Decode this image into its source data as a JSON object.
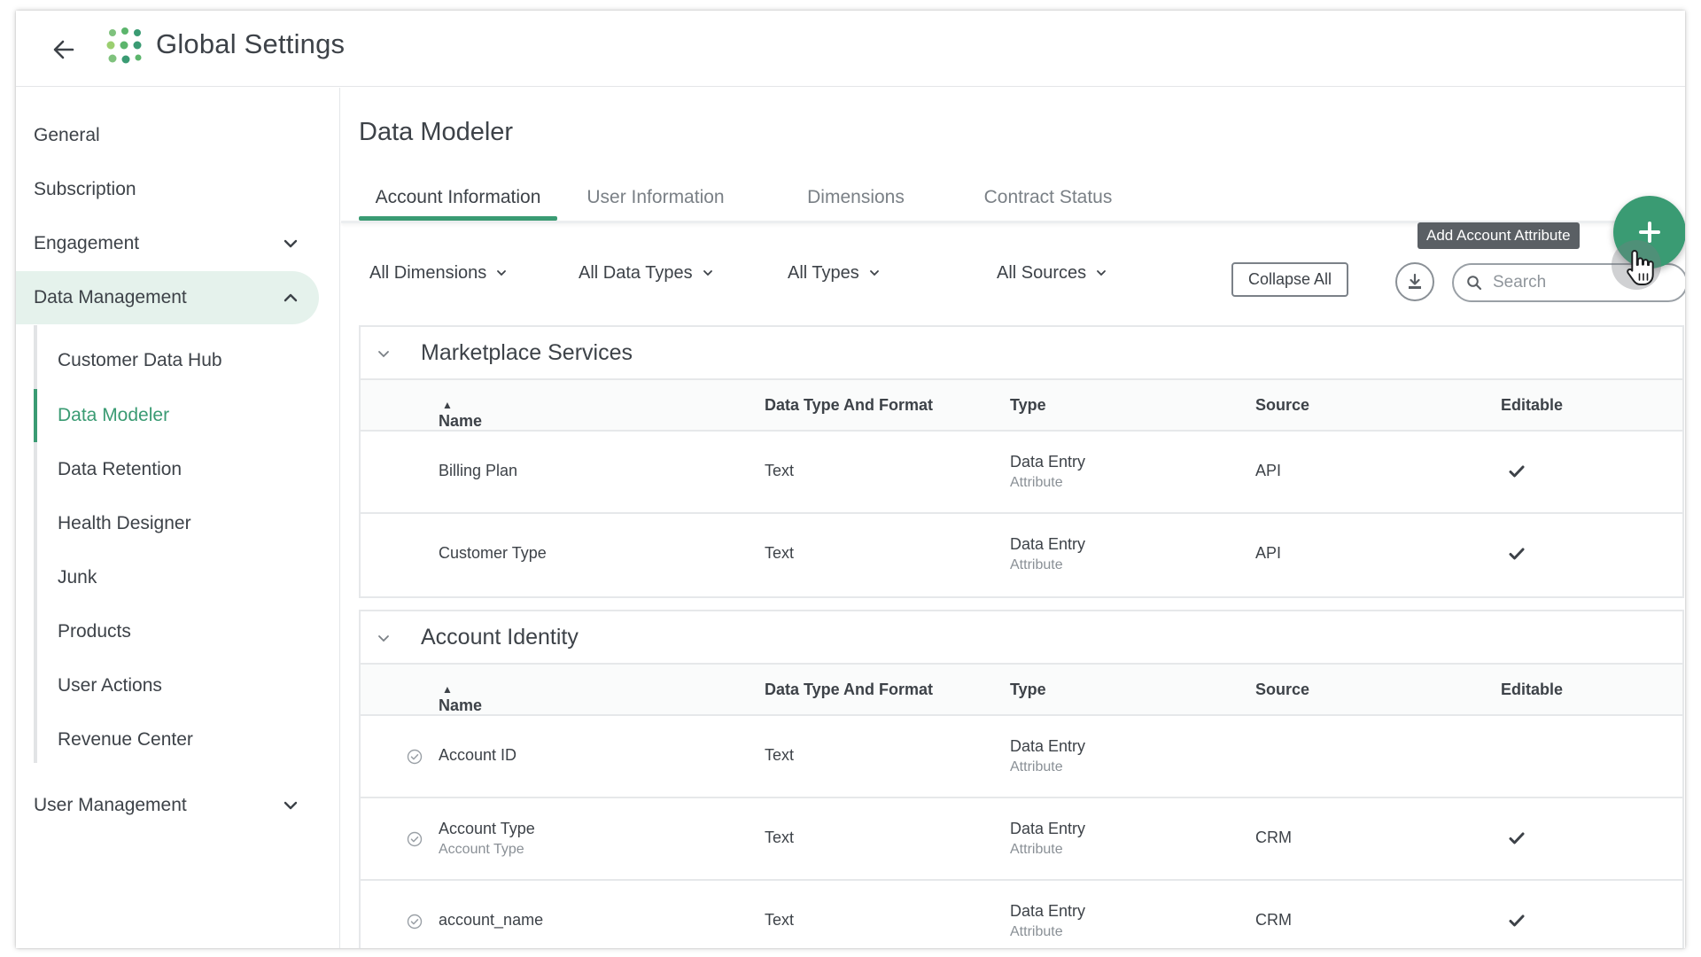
{
  "header": {
    "title": "Global Settings"
  },
  "sidebar": {
    "items": [
      {
        "label": "General"
      },
      {
        "label": "Subscription"
      },
      {
        "label": "Engagement"
      },
      {
        "label": "Data Management"
      },
      {
        "label": "User Management"
      }
    ],
    "sub_items": [
      {
        "label": "Customer Data Hub"
      },
      {
        "label": "Data Modeler"
      },
      {
        "label": "Data Retention"
      },
      {
        "label": "Health Designer"
      },
      {
        "label": "Junk"
      },
      {
        "label": "Products"
      },
      {
        "label": "User Actions"
      },
      {
        "label": "Revenue Center"
      }
    ]
  },
  "main": {
    "title": "Data Modeler",
    "tabs": [
      {
        "label": "Account Information"
      },
      {
        "label": "User Information"
      },
      {
        "label": "Dimensions"
      },
      {
        "label": "Contract Status"
      }
    ],
    "filters": [
      {
        "label": "All Dimensions"
      },
      {
        "label": "All Data Types"
      },
      {
        "label": "All Types"
      },
      {
        "label": "All Sources"
      }
    ],
    "collapse_label": "Collapse All",
    "search_placeholder": "Search",
    "add_tooltip": "Add Account Attribute",
    "columns": [
      "Name",
      "Data Type And Format",
      "Type",
      "Source",
      "Editable"
    ],
    "sections": [
      {
        "title": "Marketplace Services",
        "rows": [
          {
            "name": "Billing Plan",
            "name_sub": "",
            "data_type": "Text",
            "type": "Data Entry",
            "type_sub": "Attribute",
            "source": "API",
            "editable": true,
            "status_icon": false
          },
          {
            "name": "Customer Type",
            "name_sub": "",
            "data_type": "Text",
            "type": "Data Entry",
            "type_sub": "Attribute",
            "source": "API",
            "editable": true,
            "status_icon": false
          }
        ]
      },
      {
        "title": "Account Identity",
        "rows": [
          {
            "name": "Account ID",
            "name_sub": "",
            "data_type": "Text",
            "type": "Data Entry",
            "type_sub": "Attribute",
            "source": "",
            "editable": false,
            "status_icon": true
          },
          {
            "name": "Account Type",
            "name_sub": "Account Type",
            "data_type": "Text",
            "type": "Data Entry",
            "type_sub": "Attribute",
            "source": "CRM",
            "editable": true,
            "status_icon": true
          },
          {
            "name": "account_name",
            "name_sub": "",
            "data_type": "Text",
            "type": "Data Entry",
            "type_sub": "Attribute",
            "source": "CRM",
            "editable": true,
            "status_icon": true
          }
        ]
      }
    ]
  },
  "colors": {
    "accent": "#3a9b73",
    "active_bg": "#e5f2ec",
    "text": "#3d4248",
    "muted": "#8a9096"
  }
}
